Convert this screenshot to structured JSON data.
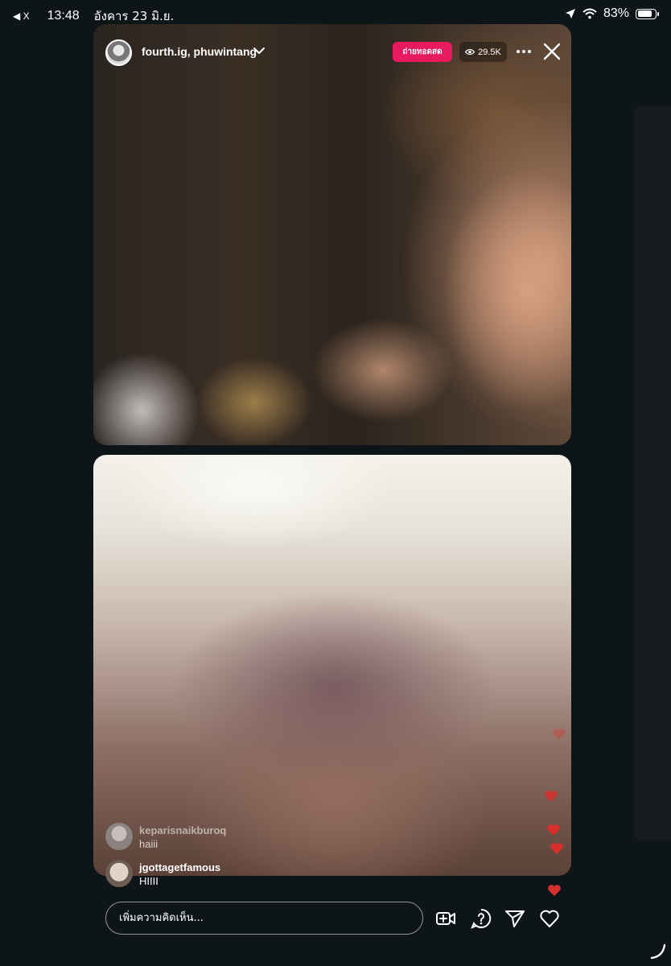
{
  "status_bar": {
    "back_label": "◀ X",
    "time": "13:48",
    "date": "อังคาร 23 มิ.ย.",
    "battery_text": "83%",
    "battery_level": 0.83
  },
  "stream": {
    "hosts": "fourth.ig, phuwintang",
    "live_label": "ถ่ายทอดสด",
    "viewers": "29.5K"
  },
  "comments": [
    {
      "user": "keparisnaikburoq",
      "message": "haiii"
    },
    {
      "user": "jgottagetfamous",
      "message": "HIIII"
    }
  ],
  "comment_bar": {
    "placeholder": "เพิ่มความคิดเห็น..."
  },
  "icons": {
    "add_guest": "add-video-icon",
    "question": "question-icon",
    "share": "send-icon",
    "like": "heart-icon"
  },
  "colors": {
    "live_badge": "#e8195c",
    "heart": "#d7302c",
    "background": "#0e1518"
  }
}
